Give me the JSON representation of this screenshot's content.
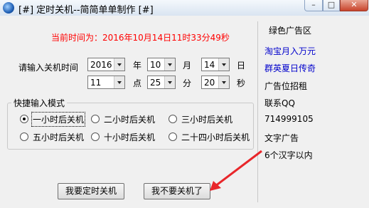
{
  "window": {
    "title": "[#] 定时关机--简简单单制作 [#]",
    "controls": {
      "minimize": "–",
      "maximize": "□",
      "close": "✕"
    }
  },
  "current_time_text": "当前时间为：2016年10月14日11时33分49秒",
  "input": {
    "label": "请输入关机时间",
    "year": "2016",
    "year_unit": "年",
    "month": "10",
    "month_unit": "月",
    "day": "14",
    "day_unit": "日",
    "hour": "11",
    "hour_unit": "点",
    "minute": "25",
    "minute_unit": "分",
    "second": "20",
    "second_unit": "秒"
  },
  "quick_mode": {
    "title": "快捷输入模式",
    "options": [
      "一小时后关机",
      "二小时后关机",
      "三小时后关机",
      "五小时后关机",
      "十小时后关机",
      "二十四小时后关机"
    ],
    "selected_index": 0
  },
  "buttons": {
    "schedule": "我要定时关机",
    "cancel": "我不要关机了"
  },
  "ads": {
    "title": "绿色广告区",
    "items": [
      {
        "text": "淘宝月入万元",
        "link": true
      },
      {
        "text": "群英夏日传奇",
        "link": true
      },
      {
        "text": "广告位招租",
        "link": false
      },
      {
        "text": "联系QQ",
        "link": false
      },
      {
        "text": "714999105",
        "link": false
      },
      {
        "text": "文字广告",
        "link": false
      },
      {
        "text": "6个汉字以内",
        "link": false
      }
    ]
  },
  "colors": {
    "time_text": "#ff0000",
    "link_text": "#0000cc",
    "annotation_arrow": "#e8262a"
  }
}
